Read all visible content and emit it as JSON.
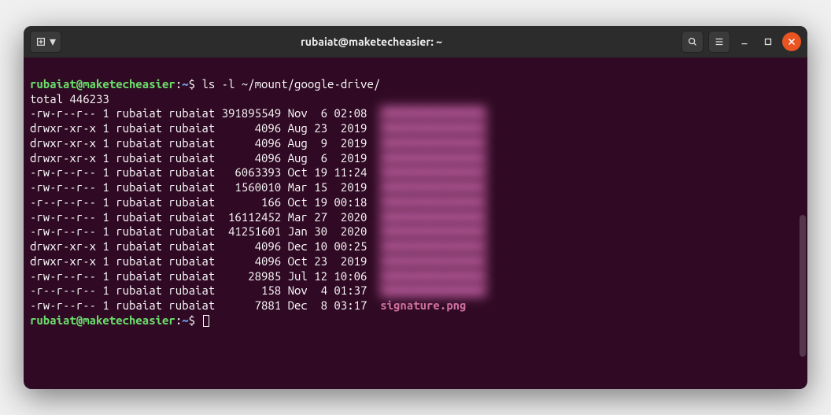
{
  "titlebar": {
    "title": "rubaiat@maketecheasier: ~"
  },
  "prompt": {
    "user_host": "rubaiat@maketecheasier",
    "sep": ":",
    "path": "~",
    "sigil": "$"
  },
  "command": "ls -l ~/mount/google-drive/",
  "total_line": "total 446233",
  "listing": [
    {
      "perm": "-rw-r--r--",
      "links": "1",
      "owner": "rubaiat",
      "group": "rubaiat",
      "size": "391895549",
      "month": "Nov",
      "day": " 6",
      "time": "02:08",
      "name": "",
      "blurred": true
    },
    {
      "perm": "drwxr-xr-x",
      "links": "1",
      "owner": "rubaiat",
      "group": "rubaiat",
      "size": "4096",
      "month": "Aug",
      "day": "23",
      "time": " 2019",
      "name": "",
      "blurred": true
    },
    {
      "perm": "drwxr-xr-x",
      "links": "1",
      "owner": "rubaiat",
      "group": "rubaiat",
      "size": "4096",
      "month": "Aug",
      "day": " 9",
      "time": " 2019",
      "name": "",
      "blurred": true
    },
    {
      "perm": "drwxr-xr-x",
      "links": "1",
      "owner": "rubaiat",
      "group": "rubaiat",
      "size": "4096",
      "month": "Aug",
      "day": " 6",
      "time": " 2019",
      "name": "",
      "blurred": true
    },
    {
      "perm": "-rw-r--r--",
      "links": "1",
      "owner": "rubaiat",
      "group": "rubaiat",
      "size": "6063393",
      "month": "Oct",
      "day": "19",
      "time": "11:24",
      "name": "",
      "blurred": true
    },
    {
      "perm": "-rw-r--r--",
      "links": "1",
      "owner": "rubaiat",
      "group": "rubaiat",
      "size": "1560010",
      "month": "Mar",
      "day": "15",
      "time": " 2019",
      "name": "",
      "blurred": true
    },
    {
      "perm": "-r--r--r--",
      "links": "1",
      "owner": "rubaiat",
      "group": "rubaiat",
      "size": "166",
      "month": "Oct",
      "day": "19",
      "time": "00:18",
      "name": "",
      "blurred": true
    },
    {
      "perm": "-rw-r--r--",
      "links": "1",
      "owner": "rubaiat",
      "group": "rubaiat",
      "size": "16112452",
      "month": "Mar",
      "day": "27",
      "time": " 2020",
      "name": "",
      "blurred": true
    },
    {
      "perm": "-rw-r--r--",
      "links": "1",
      "owner": "rubaiat",
      "group": "rubaiat",
      "size": "41251601",
      "month": "Jan",
      "day": "30",
      "time": " 2020",
      "name": "",
      "blurred": true
    },
    {
      "perm": "drwxr-xr-x",
      "links": "1",
      "owner": "rubaiat",
      "group": "rubaiat",
      "size": "4096",
      "month": "Dec",
      "day": "10",
      "time": "00:25",
      "name": "",
      "blurred": true
    },
    {
      "perm": "drwxr-xr-x",
      "links": "1",
      "owner": "rubaiat",
      "group": "rubaiat",
      "size": "4096",
      "month": "Oct",
      "day": "23",
      "time": " 2019",
      "name": "",
      "blurred": true
    },
    {
      "perm": "-rw-r--r--",
      "links": "1",
      "owner": "rubaiat",
      "group": "rubaiat",
      "size": "28985",
      "month": "Jul",
      "day": "12",
      "time": "10:06",
      "name": "",
      "blurred": true
    },
    {
      "perm": "-r--r--r--",
      "links": "1",
      "owner": "rubaiat",
      "group": "rubaiat",
      "size": "158",
      "month": "Nov",
      "day": " 4",
      "time": "01:37",
      "name": "",
      "blurred": true
    },
    {
      "perm": "-rw-r--r--",
      "links": "1",
      "owner": "rubaiat",
      "group": "rubaiat",
      "size": "7881",
      "month": "Dec",
      "day": " 8",
      "time": "03:17",
      "name": "signature.png",
      "blurred": false
    }
  ]
}
